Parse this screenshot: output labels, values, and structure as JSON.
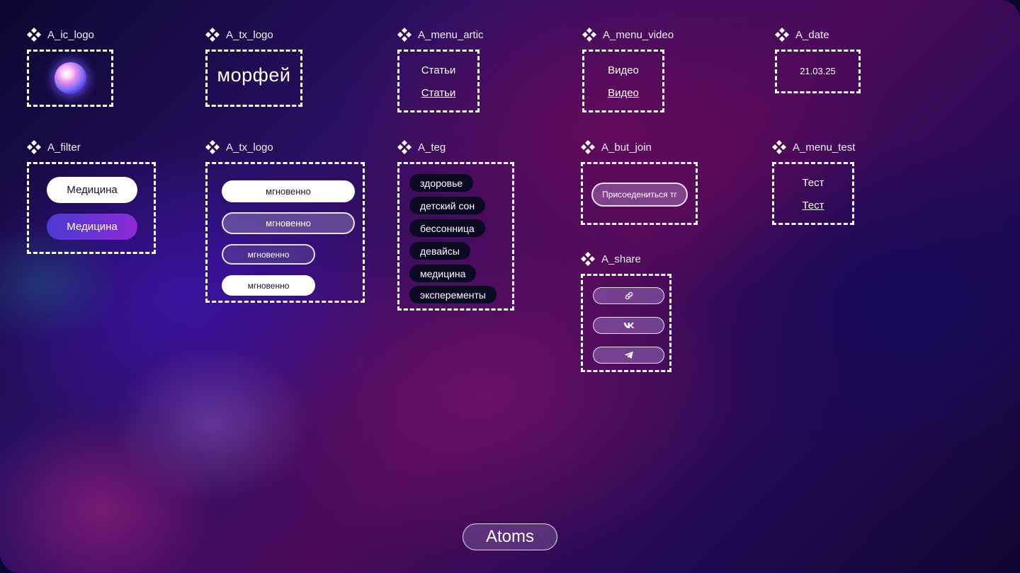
{
  "atoms": {
    "ic_logo": {
      "label": "A_ic_logo"
    },
    "tx_logo": {
      "label": "A_tx_logo",
      "text": "морфей"
    },
    "menu_artic": {
      "label": "A_menu_artic",
      "item": "Статьи",
      "item_active": "Статьи"
    },
    "menu_video": {
      "label": "A_menu_video",
      "item": "Видео",
      "item_active": "Видео"
    },
    "date": {
      "label": "A_date",
      "value": "21.03.25"
    },
    "filter": {
      "label": "A_filter",
      "default": "Медицина",
      "active": "Медицина"
    },
    "tx_logo_btn": {
      "label": "A_tx_logo",
      "variants": [
        "мгновенно",
        "мгновенно",
        "мгновенно",
        "мгновенно"
      ]
    },
    "teg": {
      "label": "A_teg",
      "items": [
        "здоровье",
        "детский сон",
        "бессонница",
        "девайсы",
        "медицина",
        "эксперементы"
      ]
    },
    "but_join": {
      "label": "A_but_join",
      "text": "Присоедениться тг"
    },
    "menu_test": {
      "label": "A_menu_test",
      "item": "Тест",
      "item_active": "Тест"
    },
    "share": {
      "label": "A_share",
      "icons": [
        "link-icon",
        "vk-icon",
        "telegram-icon"
      ]
    }
  },
  "footer": {
    "title": "Atoms"
  }
}
